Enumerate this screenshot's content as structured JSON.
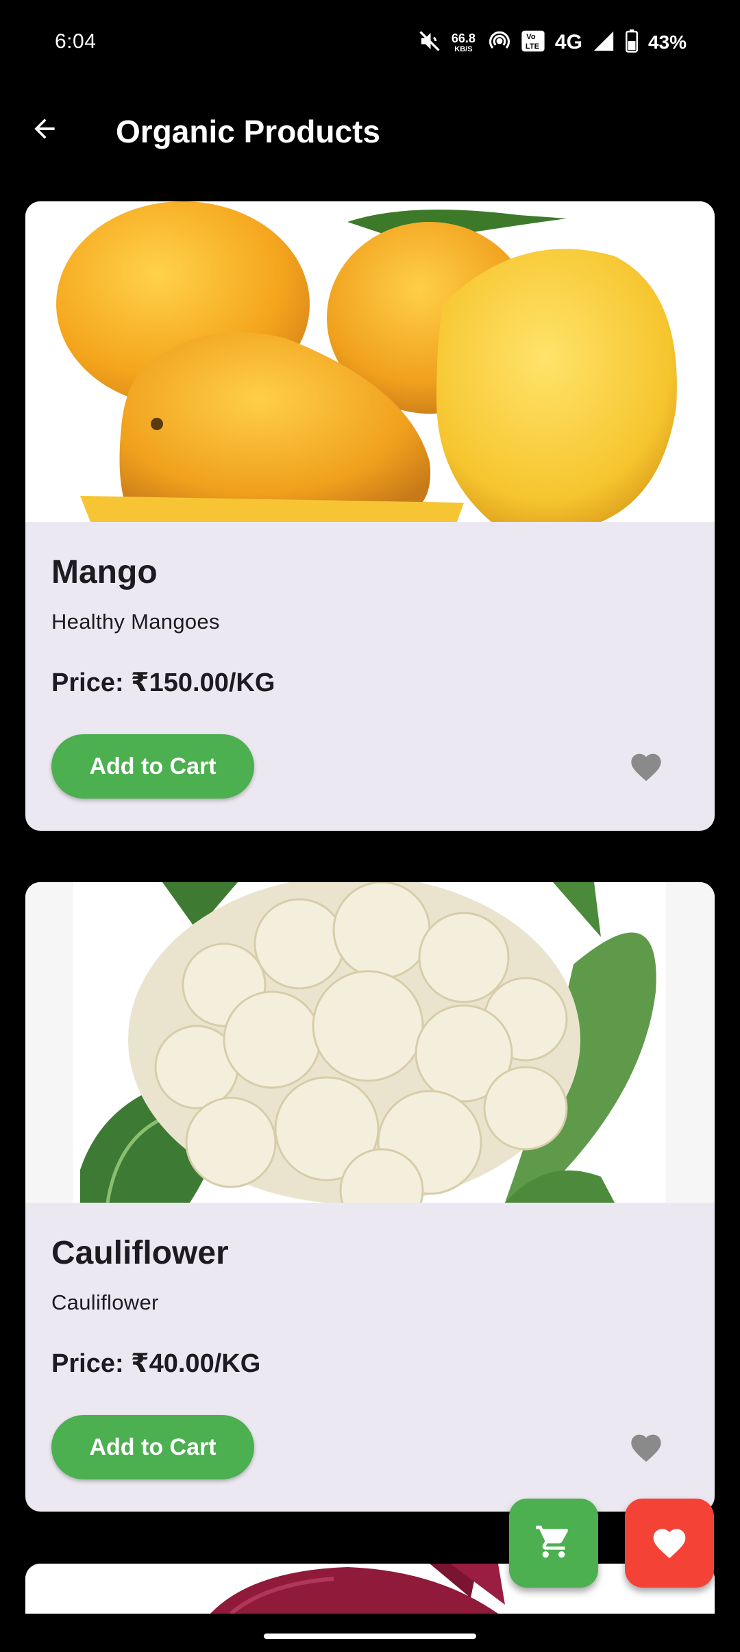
{
  "status_bar": {
    "time": "6:04",
    "net_speed_value": "66.8",
    "net_speed_unit": "KB/S",
    "network": "4G",
    "volte": "Vo LTE",
    "battery": "43%",
    "icons": [
      "mute-icon",
      "hotspot-icon",
      "volte-icon",
      "signal-icon",
      "battery-icon"
    ]
  },
  "app_bar": {
    "title": "Organic Products",
    "back_icon": "arrow-back-icon"
  },
  "products": [
    {
      "name": "Mango",
      "description": "Healthy Mangoes",
      "price": "Price: ₹150.00/KG",
      "add_label": "Add to Cart",
      "favorite_icon": "heart-icon",
      "image": "mangoes"
    },
    {
      "name": "Cauliflower",
      "description": "Cauliflower",
      "price": "Price: ₹40.00/KG",
      "add_label": "Add to Cart",
      "favorite_icon": "heart-icon",
      "image": "cauliflower"
    },
    {
      "image": "beetroot"
    }
  ],
  "fabs": {
    "cart_icon": "shopping-cart-icon",
    "favorites_icon": "heart-icon"
  },
  "colors": {
    "background": "#000000",
    "card": "#ece8f1",
    "accent_green": "#4caf50",
    "fab_red": "#f44336",
    "heart_gray": "#8a8a8a"
  }
}
